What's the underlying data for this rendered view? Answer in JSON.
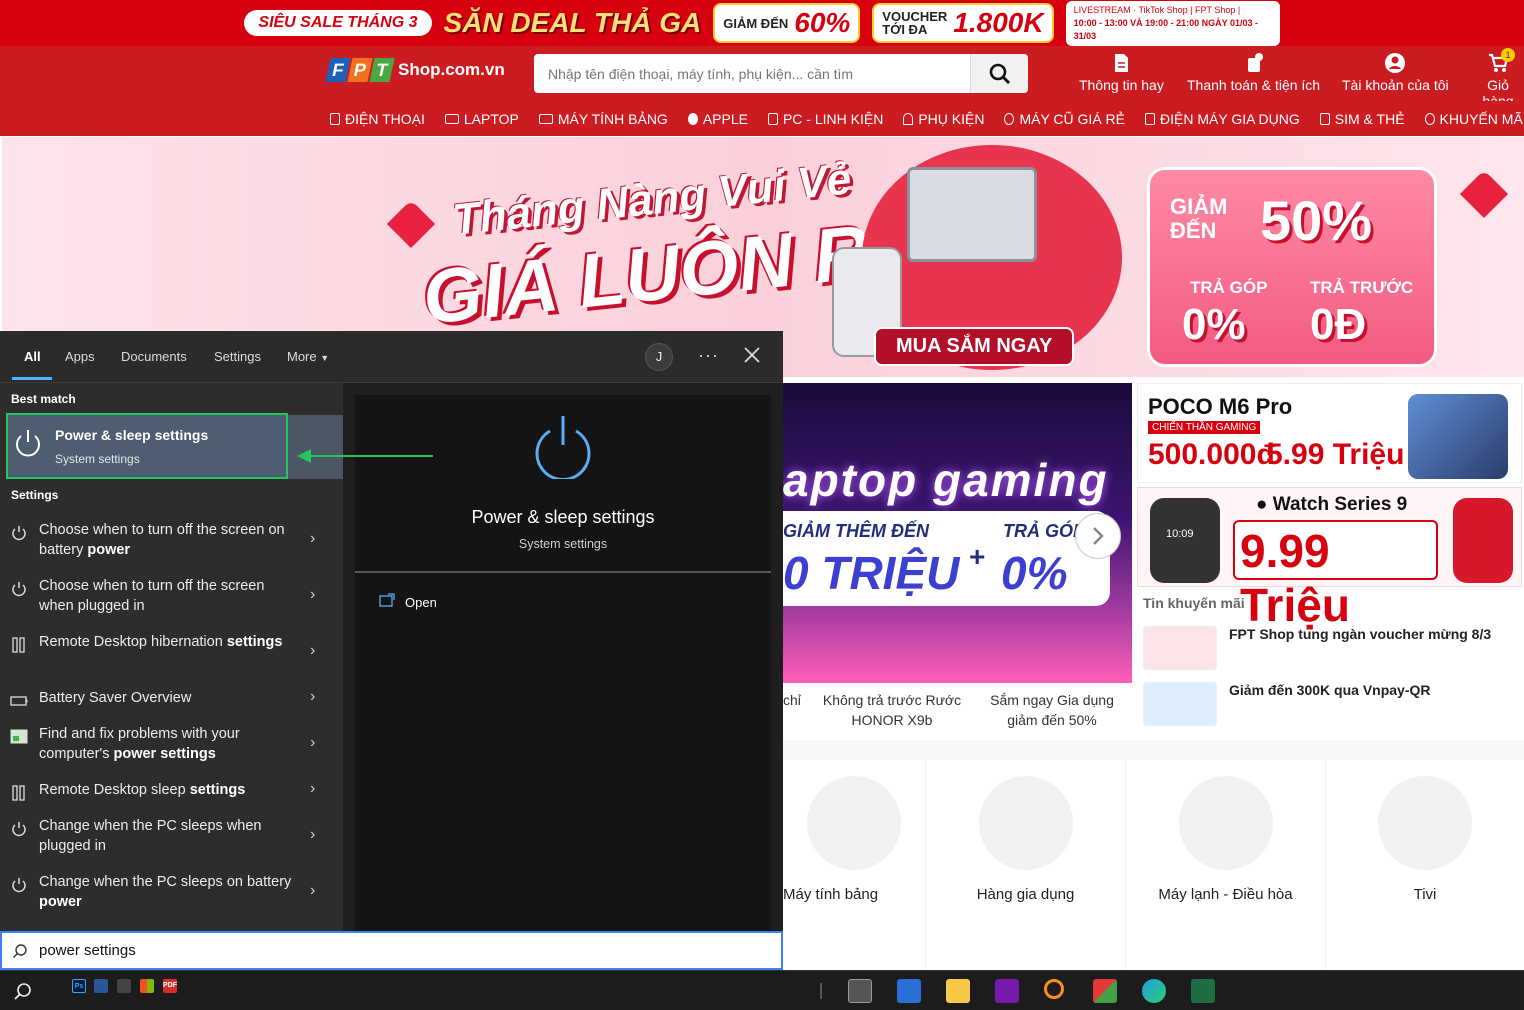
{
  "promo": {
    "sale_label": "SIÊU SALE THÁNG 3",
    "deal_title": "SĂN DEAL THẢ GA",
    "discount_label": "GIẢM ĐẾN",
    "discount_value": "60%",
    "voucher_label_1": "VOUCHER",
    "voucher_label_2": "TỚI ĐA",
    "voucher_value": "1.800K",
    "livestream_text": "LIVESTREAM · TikTok Shop | FPT Shop |",
    "livestream_time": "10:00 - 13:00 VÀ 19:00 - 21:00 NGÀY 01/03 - 31/03"
  },
  "header": {
    "logo_letters": [
      "F",
      "P",
      "T"
    ],
    "logo_shop": "Shop.com.vn",
    "search_placeholder": "Nhập tên điện thoại, máy tính, phụ kiện... cần tìm",
    "items": [
      {
        "label": "Thông tin hay",
        "icon": "document-icon"
      },
      {
        "label": "Thanh toán & tiện ích",
        "icon": "payment-icon"
      },
      {
        "label": "Tài khoản của tôi",
        "icon": "user-icon"
      },
      {
        "label": "Giỏ hàng",
        "icon": "cart-icon"
      }
    ],
    "cart_count": "1"
  },
  "nav": {
    "items": [
      "ĐIỆN THOẠI",
      "LAPTOP",
      "MÁY TÍNH BẢNG",
      "APPLE",
      "PC - LINH KIỆN",
      "PHỤ KIỆN",
      "MÁY CŨ GIÁ RẺ",
      "ĐIỆN MÁY GIA DỤNG",
      "SIM & THẺ",
      "KHUYẾN MÃI"
    ]
  },
  "hero": {
    "title_1": "Tháng Nàng Vui Vẻ",
    "title_2": "GIÁ LUÔN RẺ",
    "shop_button": "MUA SẮM NGAY",
    "discount_label": "GIẢM ĐẾN",
    "discount_value": "50%",
    "installment_label": "TRẢ GÓP",
    "installment_value": "0%",
    "prepay_label": "TRẢ TRƯỚC",
    "prepay_value": "0Đ"
  },
  "gaming_banner": {
    "title": "aptop gaming",
    "left_label": "GIẢM THÊM ĐẾN",
    "right_label": "TRẢ GÓP",
    "left_value": "0 TRIỆU",
    "plus": "+",
    "right_value": "0%"
  },
  "captions": [
    {
      "text": "chỉ"
    },
    {
      "text": "Không trả trước Rước HONOR X9b"
    },
    {
      "text": "Sắm ngay Gia dụng giảm đến 50%"
    }
  ],
  "poco": {
    "title": "POCO M6 Pro",
    "sub": "CHIẾN THẦN GAMING",
    "price_1": "500.000đ",
    "price_2": "5.99 Triệu"
  },
  "watch": {
    "title": "Watch Series 9",
    "price": "9.99 Triệu",
    "watch_face": "10:09"
  },
  "promo_news": {
    "title": "Tin khuyến mãi",
    "items": [
      {
        "text": "FPT Shop tung ngàn voucher mừng 8/3"
      },
      {
        "text": "Giảm đến 300K qua Vnpay-QR"
      }
    ]
  },
  "categories": [
    "Máy tính bảng",
    "Hàng gia dụng",
    "Máy lạnh - Điều hòa",
    "Tivi"
  ],
  "win_search": {
    "tabs": [
      "All",
      "Apps",
      "Documents",
      "Settings",
      "More"
    ],
    "avatar": "J",
    "more_dots": "···",
    "best_match_label": "Best match",
    "best_match": {
      "title_prefix": "Power",
      "title_rest": " & sleep settings",
      "subtitle": "System settings"
    },
    "settings_label": "Settings",
    "results": [
      {
        "text": "Choose when to turn off the screen on battery ",
        "bold": "power",
        "icon": "power-icon"
      },
      {
        "text": "Choose when to turn off the screen when plugged in",
        "bold": "",
        "icon": "power-icon"
      },
      {
        "text": "Remote Desktop hibernation ",
        "bold": "settings",
        "icon": "remote-desktop-icon"
      },
      {
        "text": "Battery Saver Overview",
        "bold": "",
        "icon": "battery-icon"
      },
      {
        "text": "Find and fix problems with your computer's ",
        "bold": "power settings",
        "icon": "troubleshoot-icon"
      },
      {
        "text": "Remote Desktop sleep ",
        "bold": "settings",
        "icon": "remote-desktop-icon"
      },
      {
        "text": "Change when the PC sleeps when plugged in",
        "bold": "",
        "icon": "power-icon"
      },
      {
        "text": "Change when the PC sleeps on battery ",
        "bold": "power",
        "icon": "power-icon"
      }
    ],
    "detail": {
      "title": "Power & sleep settings",
      "subtitle": "System settings",
      "open_label": "Open"
    },
    "query": "power settings"
  },
  "colors": {
    "brand_red": "#cb1c22",
    "highlight_green": "#22c55e",
    "focus_blue": "#3b82f6"
  }
}
